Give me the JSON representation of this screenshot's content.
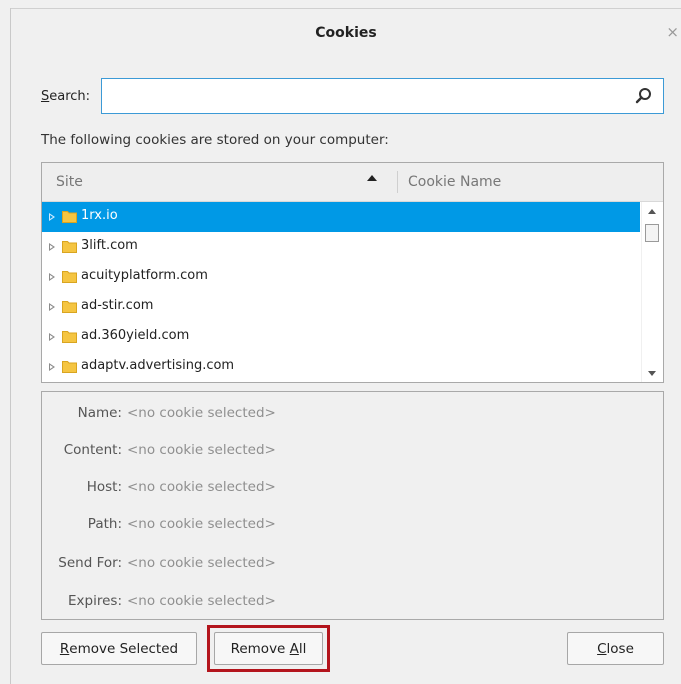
{
  "window": {
    "title": "Cookies",
    "close_glyph": "×"
  },
  "search": {
    "label_access_key": "S",
    "label_rest": "earch:",
    "value": "",
    "placeholder": "",
    "icon": "search-icon"
  },
  "stored_text": "The following cookies are stored on your computer:",
  "tree": {
    "columns": {
      "site": "Site",
      "cookie_name": "Cookie Name"
    },
    "sort": "ascending",
    "rows": [
      {
        "site": "1rx.io",
        "selected": true
      },
      {
        "site": "3lift.com",
        "selected": false
      },
      {
        "site": "acuityplatform.com",
        "selected": false
      },
      {
        "site": "ad-stir.com",
        "selected": false
      },
      {
        "site": "ad.360yield.com",
        "selected": false
      },
      {
        "site": "adaptv.advertising.com",
        "selected": false
      }
    ]
  },
  "details": {
    "name_label": "Name:",
    "name_value": "<no cookie selected>",
    "content_label": "Content:",
    "content_value": "<no cookie selected>",
    "host_label": "Host:",
    "host_value": "<no cookie selected>",
    "path_label": "Path:",
    "path_value": "<no cookie selected>",
    "send_for_label": "Send For:",
    "send_for_value": "<no cookie selected>",
    "expires_label": "Expires:",
    "expires_value": "<no cookie selected>"
  },
  "buttons": {
    "remove_selected_key": "R",
    "remove_selected_rest": "emove Selected",
    "remove_all_pre": "Remove ",
    "remove_all_key": "A",
    "remove_all_rest": "ll",
    "close_key": "C",
    "close_rest": "lose"
  },
  "colors": {
    "selection": "#0099e6",
    "search_border": "#3c9ad6",
    "highlight_box": "#b3141c",
    "folder": "#f5c542"
  }
}
